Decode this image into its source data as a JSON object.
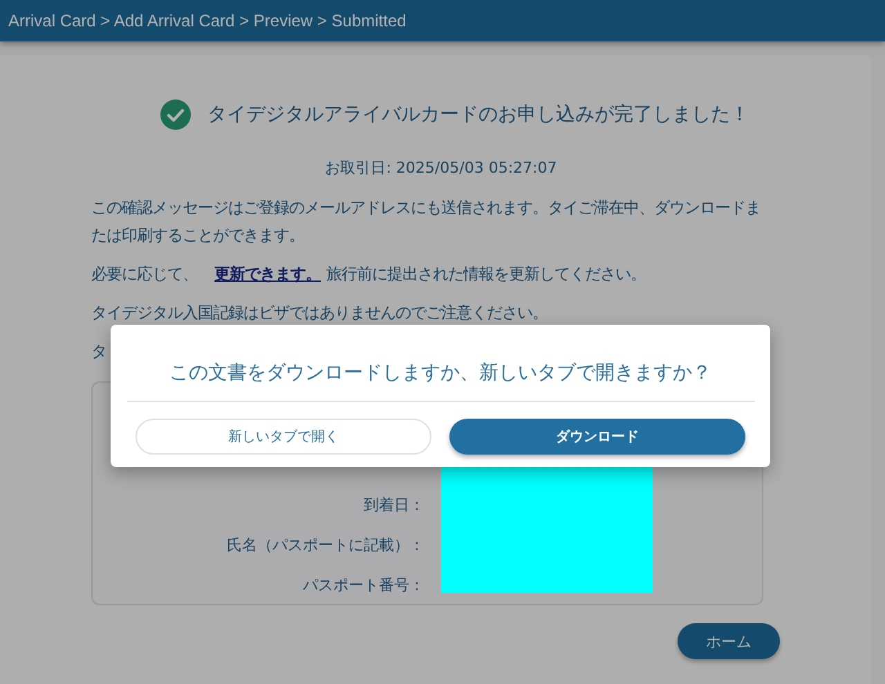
{
  "breadcrumb": "Arrival Card > Add Arrival Card > Preview > Submitted",
  "success": {
    "message": "タイデジタルアライバルカードのお申し込みが完了しました！"
  },
  "transaction_date": "お取引日: 2025/05/03 05:27:07",
  "paragraphs": [
    {
      "kind": "plain",
      "text": "この確認メッセージはご登録のメールアドレスにも送信されます。タイご滞在中、ダウンロードまたは印刷することができます。"
    },
    {
      "kind": "link",
      "before": "必要に応じて、",
      "link": "更新できます。",
      "after": "旅行前に提出された情報を更新してください。"
    },
    {
      "kind": "plain",
      "text": "タイデジタル入国記録はビザではありませんのでご注意ください。"
    },
    {
      "kind": "plain",
      "text": "タ"
    }
  ],
  "details": {
    "redacted": true,
    "fields": [
      {
        "label": "到着日："
      },
      {
        "label": "氏名（パスポートに記載）："
      },
      {
        "label": "パスポート番号："
      }
    ]
  },
  "home_button": "ホーム",
  "dialog": {
    "question": "この文書をダウンロードしますか、新しいタブで開きますか？",
    "buttons": [
      {
        "label": "新しいタブで開く",
        "kind": "secondary"
      },
      {
        "label": "ダウンロード",
        "kind": "primary"
      }
    ]
  }
}
